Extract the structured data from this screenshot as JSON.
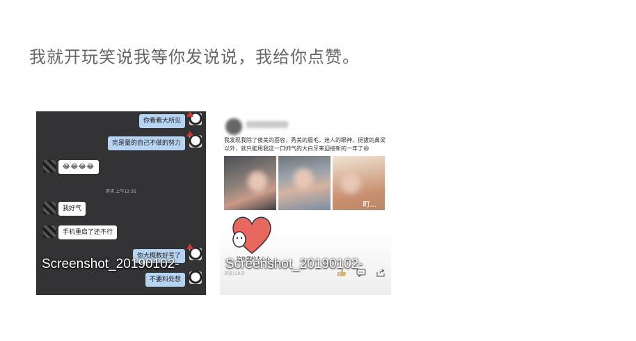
{
  "headline": "我就开玩笑说我等你发说说，我给你点赞。",
  "thumbnails": [
    {
      "caption": "Screenshot_20190102-",
      "chat": {
        "messages": [
          {
            "side": "right",
            "text": "你看看大所见"
          },
          {
            "side": "right",
            "text": "完是量的自己不做的努力"
          },
          {
            "side": "left",
            "text": "😂😂😂😂"
          },
          {
            "side": "left",
            "text": "我好气"
          },
          {
            "side": "left",
            "text": "手机重启了还不行"
          },
          {
            "side": "right",
            "text": "你大概数好号了"
          },
          {
            "side": "right",
            "text": "不要料处想"
          }
        ],
        "timestamp": "昨天 上午12:35"
      }
    },
    {
      "caption": "Screenshot_20190102-",
      "feed": {
        "post_text": "我发现我除了傻美的面容，秀美的眉毛，迷人的眼神，挺拔的鼻梁以外，就只能用我这一口帅气的大白牙来迎接新的一年了😄",
        "photo_label": "町...",
        "sticker_text": "给你我的大心心",
        "views": "浏览150次"
      }
    }
  ],
  "colors": {
    "headline": "#666666",
    "chat_background": "#333336",
    "bubble_right": "#b6d4f2",
    "bubble_left": "#ffffff",
    "heart": "#e8675f"
  }
}
